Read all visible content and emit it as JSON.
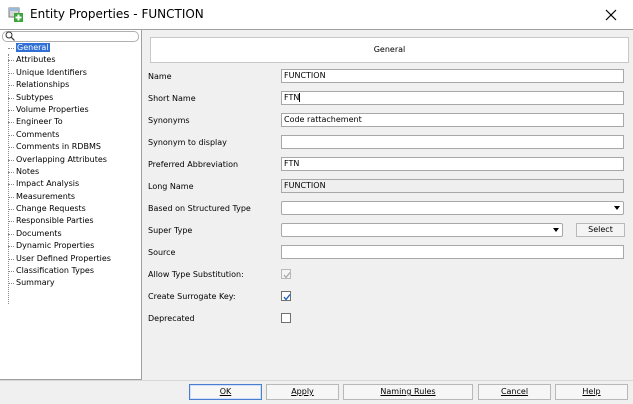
{
  "window": {
    "title": "Entity Properties - FUNCTION",
    "close_glyph": "✕"
  },
  "tree": {
    "items": [
      {
        "label": "General",
        "selected": true
      },
      {
        "label": "Attributes"
      },
      {
        "label": "Unique Identifiers"
      },
      {
        "label": "Relationships"
      },
      {
        "label": "Subtypes"
      },
      {
        "label": "Volume Properties"
      },
      {
        "label": "Engineer To"
      },
      {
        "label": "Comments"
      },
      {
        "label": "Comments in RDBMS"
      },
      {
        "label": "Overlapping Attributes"
      },
      {
        "label": "Notes"
      },
      {
        "label": "Impact Analysis"
      },
      {
        "label": "Measurements"
      },
      {
        "label": "Change Requests"
      },
      {
        "label": "Responsible Parties"
      },
      {
        "label": "Documents"
      },
      {
        "label": "Dynamic Properties"
      },
      {
        "label": "User Defined Properties"
      },
      {
        "label": "Classification Types"
      },
      {
        "label": "Summary"
      }
    ]
  },
  "general": {
    "header": "General",
    "name_label": "Name",
    "name_value": "FUNCTION",
    "short_name_label": "Short Name",
    "short_name_value": "FTN",
    "synonyms_label": "Synonyms",
    "synonyms_value": "Code rattachement",
    "synonym_display_label": "Synonym to display",
    "synonym_display_value": "",
    "pref_abbrev_label": "Preferred Abbreviation",
    "pref_abbrev_value": "FTN",
    "long_name_label": "Long Name",
    "long_name_value": "FUNCTION",
    "structured_type_label": "Based on Structured Type",
    "super_type_label": "Super Type",
    "select_button": "Select",
    "source_label": "Source",
    "source_value": "",
    "allow_subst_label": "Allow Type Substitution:",
    "allow_subst_checked": true,
    "surrogate_label": "Create Surrogate Key:",
    "surrogate_checked": true,
    "deprecated_label": "Deprecated",
    "deprecated_checked": false
  },
  "buttons": {
    "ok": "OK",
    "apply": "Apply",
    "naming_rules": "Naming Rules",
    "cancel": "Cancel",
    "help": "Help"
  },
  "colors": {
    "selection": "#2f6fd6",
    "check": "#1f5fbf",
    "icon_green": "#3aa63a"
  }
}
